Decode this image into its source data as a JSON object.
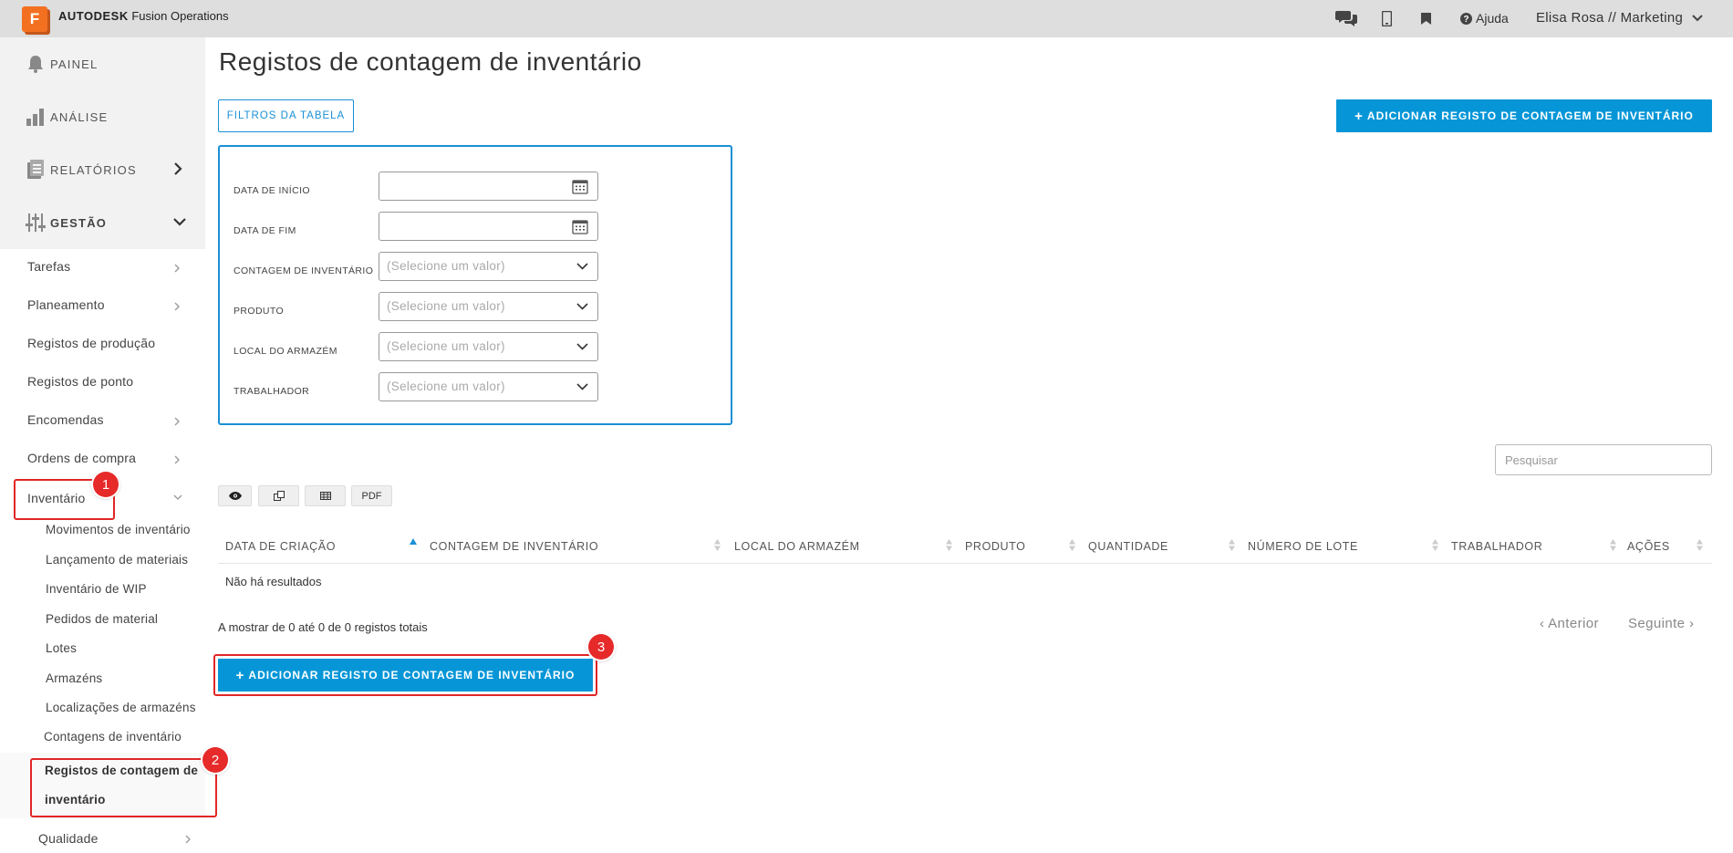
{
  "topbar": {
    "logo_letter": "F",
    "brand_strong": "AUTODESK",
    "brand_product": "Fusion Operations",
    "help_label": "Ajuda",
    "user_label": "Elisa Rosa // Marketing"
  },
  "sidebar": {
    "main": [
      {
        "label": "PAINEL",
        "icon": "bell-icon"
      },
      {
        "label": "ANÁLISE",
        "icon": "bar-chart-icon"
      },
      {
        "label": "RELATÓRIOS",
        "icon": "document-icon"
      },
      {
        "label": "GESTÃO",
        "icon": "sliders-icon"
      }
    ],
    "sub": [
      "Tarefas",
      "Planeamento",
      "Registos de produção",
      "Registos de ponto",
      "Encomendas",
      "Ordens de compra",
      "Inventário"
    ],
    "inventory_items": [
      "Movimentos de inventário",
      "Lançamento de materiais",
      "Inventário de WIP",
      "Pedidos de material",
      "Lotes",
      "Armazéns",
      "Localizações de armazéns",
      "Contagens de inventário"
    ],
    "active_item_line1": "Registos de contagem de",
    "active_item_line2": "inventário",
    "quality": "Qualidade"
  },
  "badges": [
    "1",
    "2",
    "3"
  ],
  "main": {
    "title": "Registos de contagem de inventário",
    "filters_button": "FILTROS DA TABELA",
    "add_button": "ADICIONAR REGISTO DE CONTAGEM DE INVENTÁRIO",
    "filters": [
      {
        "label": "DATA DE INÍCIO",
        "type": "date",
        "placeholder": ""
      },
      {
        "label": "DATA DE FIM",
        "type": "date",
        "placeholder": ""
      },
      {
        "label": "CONTAGEM DE INVENTÁRIO",
        "type": "select",
        "placeholder": "(Selecione um valor)"
      },
      {
        "label": "PRODUTO",
        "type": "select",
        "placeholder": "(Selecione um valor)"
      },
      {
        "label": "LOCAL DO ARMAZÉM",
        "type": "select",
        "placeholder": "(Selecione um valor)"
      },
      {
        "label": "TRABALHADOR",
        "type": "select",
        "placeholder": "(Selecione um valor)"
      }
    ],
    "search_placeholder": "Pesquisar",
    "tools": {
      "pdf": "PDF"
    },
    "columns": [
      "DATA DE CRIAÇÃO",
      "CONTAGEM DE INVENTÁRIO",
      "LOCAL DO ARMAZÉM",
      "PRODUTO",
      "QUANTIDADE",
      "NÚMERO DE LOTE",
      "TRABALHADOR",
      "AÇÕES"
    ],
    "no_results": "Não há resultados",
    "info": "A mostrar de 0 até 0 de 0 registos totais",
    "prev": "Anterior",
    "next": "Seguinte"
  },
  "colors": {
    "accent": "#0696d7",
    "highlight": "#e12626",
    "logo": "#f37021"
  }
}
